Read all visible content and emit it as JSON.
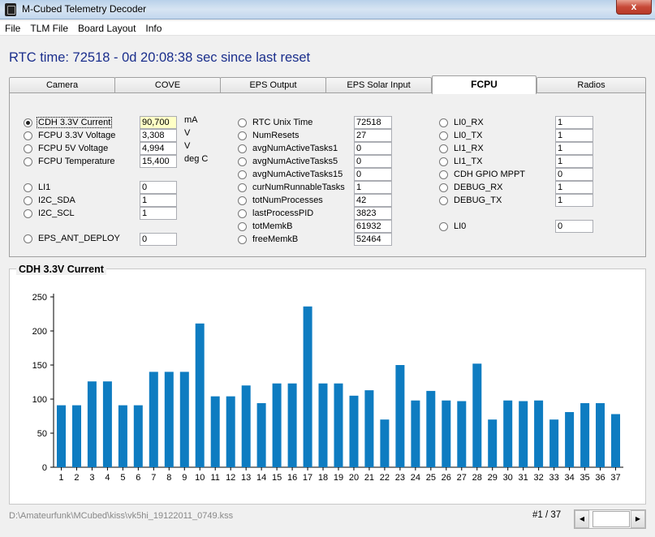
{
  "window": {
    "title": "M-Cubed Telemetry Decoder",
    "close_glyph": "x",
    "icon": "satellite-app-icon"
  },
  "menu": [
    "File",
    "TLM File",
    "Board Layout",
    "Info"
  ],
  "rtc_text": "RTC time: 72518 - 0d 20:08:38 sec since last reset",
  "tabs": [
    {
      "label": "Camera",
      "active": false
    },
    {
      "label": "COVE",
      "active": false
    },
    {
      "label": "EPS Output",
      "active": false
    },
    {
      "label": "EPS Solar Input",
      "active": false
    },
    {
      "label": "FCPU",
      "active": true
    },
    {
      "label": "Radios",
      "active": false
    }
  ],
  "col1": [
    {
      "label": "CDH 3.3V Current",
      "value": "90,700",
      "unit": "mA",
      "selected": true,
      "highlight": true
    },
    {
      "label": "FCPU 3.3V Voltage",
      "value": "3,308",
      "unit": "V",
      "selected": false
    },
    {
      "label": "FCPU 5V Voltage",
      "value": "4,994",
      "unit": "V",
      "selected": false
    },
    {
      "label": "FCPU Temperature",
      "value": "15,400",
      "unit": "deg C",
      "selected": false
    },
    {
      "label": "LI1",
      "value": "0",
      "unit": "",
      "selected": false
    },
    {
      "label": "I2C_SDA",
      "value": "1",
      "unit": "",
      "selected": false
    },
    {
      "label": "I2C_SCL",
      "value": "1",
      "unit": "",
      "selected": false
    },
    {
      "label": "EPS_ANT_DEPLOY",
      "value": "0",
      "unit": "",
      "selected": false
    }
  ],
  "col2": [
    {
      "label": "RTC Unix Time",
      "value": "72518"
    },
    {
      "label": "NumResets",
      "value": "27"
    },
    {
      "label": "avgNumActiveTasks1",
      "value": "0"
    },
    {
      "label": "avgNumActiveTasks5",
      "value": "0"
    },
    {
      "label": "avgNumActiveTasks15",
      "value": "0"
    },
    {
      "label": "curNumRunnableTasks",
      "value": "1"
    },
    {
      "label": "totNumProcesses",
      "value": "42"
    },
    {
      "label": "lastProcessPID",
      "value": "3823"
    },
    {
      "label": "totMemkB",
      "value": "61932"
    },
    {
      "label": "freeMemkB",
      "value": "52464"
    }
  ],
  "col3": [
    {
      "label": "LI0_RX",
      "value": "1"
    },
    {
      "label": "LI0_TX",
      "value": "1"
    },
    {
      "label": "LI1_RX",
      "value": "1"
    },
    {
      "label": "LI1_TX",
      "value": "1"
    },
    {
      "label": "CDH GPIO MPPT",
      "value": "0"
    },
    {
      "label": "DEBUG_RX",
      "value": "1"
    },
    {
      "label": "DEBUG_TX",
      "value": "1"
    },
    {
      "label": "LI0",
      "value": "0"
    }
  ],
  "chart_data": {
    "type": "bar",
    "title": "CDH 3.3V Current",
    "categories": [
      "1",
      "2",
      "3",
      "4",
      "5",
      "6",
      "7",
      "8",
      "9",
      "10",
      "11",
      "12",
      "13",
      "14",
      "15",
      "16",
      "17",
      "18",
      "19",
      "20",
      "21",
      "22",
      "23",
      "24",
      "25",
      "26",
      "27",
      "28",
      "29",
      "30",
      "31",
      "32",
      "33",
      "34",
      "35",
      "36",
      "37"
    ],
    "values": [
      91,
      91,
      126,
      126,
      91,
      91,
      140,
      140,
      140,
      211,
      104,
      104,
      120,
      94,
      123,
      123,
      236,
      123,
      123,
      105,
      113,
      70,
      150,
      98,
      112,
      98,
      97,
      152,
      70,
      98,
      97,
      98,
      70,
      81,
      94,
      94,
      78
    ],
    "ylim": [
      0,
      250
    ],
    "yticks": [
      "0",
      "50",
      "100",
      "150",
      "200",
      "250"
    ],
    "bar_color": "#0e7cc1",
    "grid": false,
    "legend": "none"
  },
  "status": {
    "path": "D:\\Amateurfunk\\MCubed\\kiss\\vk5hi_19122011_0749.kss",
    "page": "#1 / 37"
  }
}
